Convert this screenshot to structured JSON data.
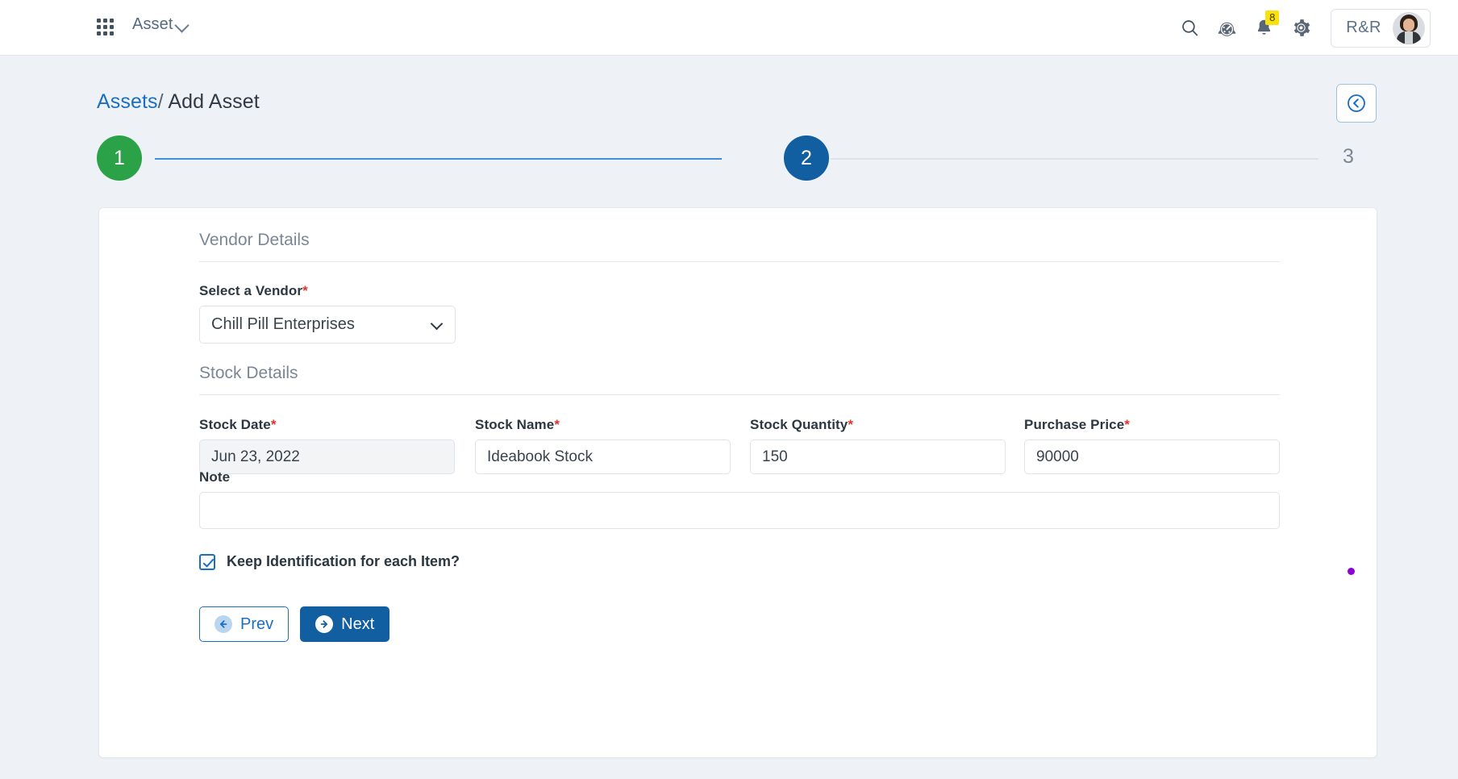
{
  "topbar": {
    "apps_icon": "grid-apps-icon",
    "app_name": "Asset",
    "search_icon": "search-icon",
    "dashboard_icon": "speedometer-icon",
    "notifications_icon": "bell-icon",
    "notifications_count": "8",
    "settings_icon": "gear-icon",
    "user_initials": "R&R",
    "avatar_icon": "user-avatar"
  },
  "page": {
    "breadcrumb_parent": "Assets",
    "breadcrumb_separator": "/",
    "breadcrumb_current": "Add Asset",
    "back_icon": "circle-chevron-left-icon"
  },
  "stepper": {
    "steps": [
      {
        "label": "1",
        "state": "completed",
        "color": "#2ba148"
      },
      {
        "label": "2",
        "state": "active",
        "color": "#115fa0"
      },
      {
        "label": "3",
        "state": "pending",
        "color": "#7b8794"
      }
    ]
  },
  "form": {
    "vendor_section_title": "Vendor Details",
    "vendor_label": "Select a Vendor",
    "vendor_value": "Chill Pill Enterprises",
    "vendor_caret_icon": "chevron-down-icon",
    "stock_section_title": "Stock Details",
    "stock_date_label": "Stock Date",
    "stock_date_value": "Jun 23, 2022",
    "stock_name_label": "Stock Name",
    "stock_name_value": "Ideabook Stock",
    "stock_qty_label": "Stock Quantity",
    "stock_qty_value": "150",
    "purchase_price_label": "Purchase Price",
    "purchase_price_value": "90000",
    "note_label": "Note",
    "note_value": "",
    "note_placeholder": "",
    "keep_id_label": "Keep Identification for each Item?",
    "keep_id_checked": true,
    "required_marker": "*"
  },
  "actions": {
    "prev_label": "Prev",
    "prev_icon": "arrow-left-circle-icon",
    "next_label": "Next",
    "next_icon": "arrow-right-circle-icon"
  },
  "cursor": {
    "indicator": "purple-dot",
    "color": "#8e00d8"
  }
}
